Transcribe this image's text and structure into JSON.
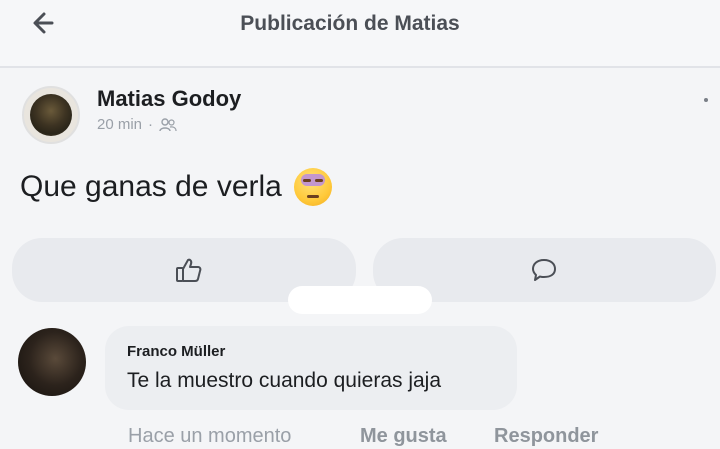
{
  "header": {
    "title": "Publicación de Matias",
    "back_icon": "back-arrow-icon"
  },
  "post": {
    "author": "Matias Godoy",
    "time": "20 min",
    "separator": "·",
    "audience_icon": "friends-icon",
    "text": "Que ganas de verla",
    "emoji": "blushing-face-emoji"
  },
  "actions": {
    "like_icon": "thumbs-up-icon",
    "comment_icon": "comment-bubble-icon"
  },
  "comment": {
    "author": "Franco Müller",
    "text": "Te la muestro cuando quieras jaja",
    "timestamp": "Hace un momento",
    "like_label": "Me gusta",
    "reply_label": "Responder"
  }
}
